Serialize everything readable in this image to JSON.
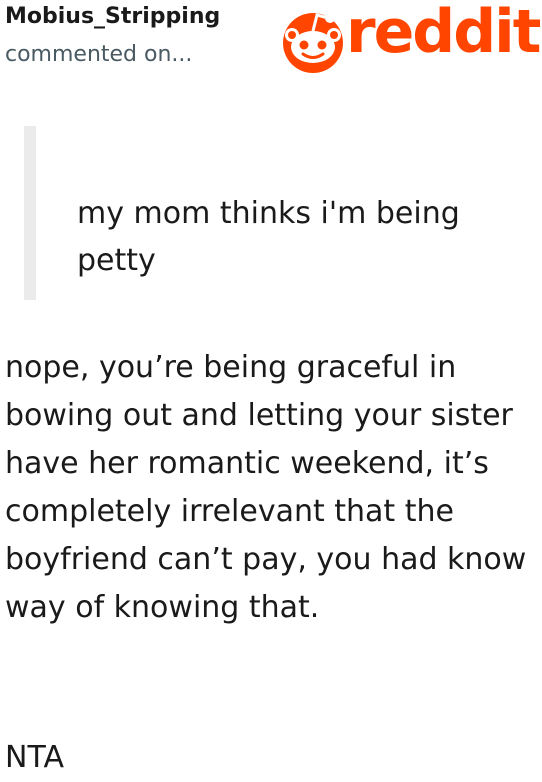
{
  "header": {
    "username": "Mobius_Stripping",
    "subtitle": "commented on...",
    "logo_text": "reddit",
    "logo_icon": "reddit-snoo-icon"
  },
  "comment": {
    "quote": "my mom thinks i'm being petty",
    "body": "nope, you’re being graceful in bowing out and letting your sister have her romantic weekend, it’s completely irrelevant that the boyfriend can’t pay, you had know way of knowing that.",
    "verdict": "NTA"
  },
  "colors": {
    "brand": "#ff4500",
    "text": "#1a1a1b",
    "muted": "#4a5a63",
    "quote_bar": "#ebebeb"
  }
}
